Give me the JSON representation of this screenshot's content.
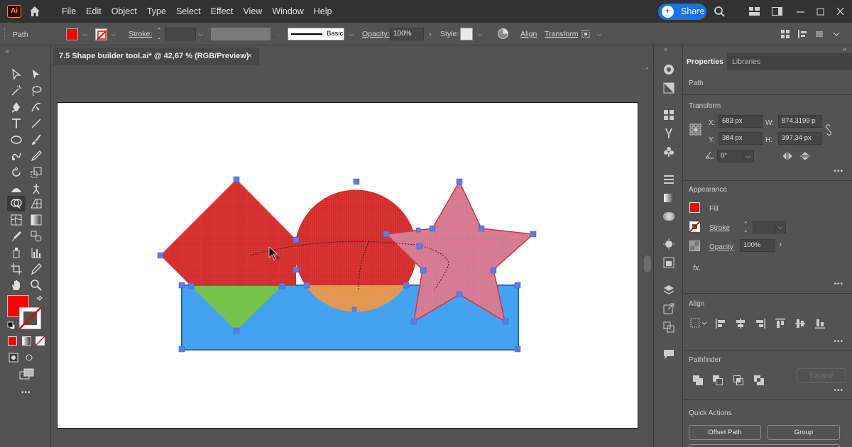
{
  "app": {
    "logo": "Ai"
  },
  "menu": [
    "File",
    "Edit",
    "Object",
    "Type",
    "Select",
    "Effect",
    "View",
    "Window",
    "Help"
  ],
  "share_label": "Share",
  "control": {
    "selection_type": "Path",
    "stroke_label": "Stroke:",
    "brush_label": "Basic",
    "opacity_label": "Opacity:",
    "opacity_value": "100%",
    "style_label": "Style:",
    "align_label": "Align",
    "transform_label": "Transform"
  },
  "document": {
    "tab_title": "7.5 Shape builder tool.ai* @ 42,67 % (RGB/Preview)",
    "close": "×"
  },
  "properties": {
    "tabs": [
      "Properties",
      "Libraries"
    ],
    "object_type": "Path",
    "transform": {
      "title": "Transform",
      "x_label": "X:",
      "x": "683 px",
      "y_label": "Y:",
      "y": "384 px",
      "w_label": "W:",
      "w": "874,3199 p",
      "h_label": "H:",
      "h": "397,34 px",
      "angle": "0°"
    },
    "appearance": {
      "title": "Appearance",
      "fill": "Fill",
      "stroke": "Stroke",
      "opacity_label": "Opacity",
      "opacity": "100%",
      "fx": "fx."
    },
    "align_title": "Align",
    "pathfinder": {
      "title": "Pathfinder",
      "expand": "Expand"
    },
    "quick_actions": {
      "title": "Quick Actions",
      "offset_path": "Offset Path",
      "group": "Group"
    },
    "more": "•••"
  },
  "colors": {
    "fill": "#ff0000",
    "accent": "#1473e6",
    "selection": "#5b7ee5"
  }
}
